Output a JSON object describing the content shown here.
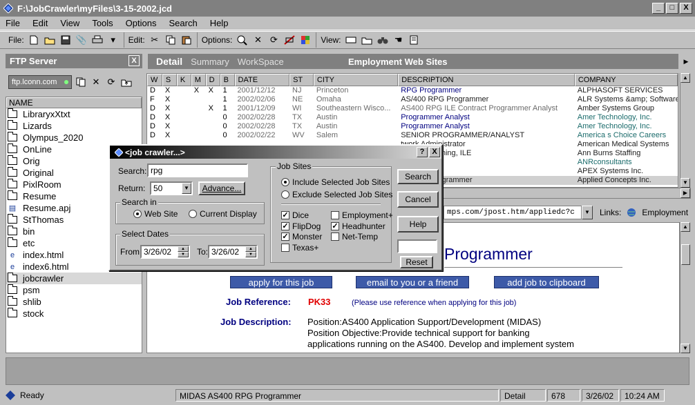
{
  "window": {
    "title": "F:\\JobCrawler\\myFiles\\3-15-2002.jcd",
    "min": "_",
    "max": "□",
    "close": "X"
  },
  "menu": [
    "File",
    "Edit",
    "View",
    "Tools",
    "Options",
    "Search",
    "Help"
  ],
  "toolbar": {
    "file_label": "File:",
    "edit_label": "Edit:",
    "options_label": "Options:",
    "view_label": "View:"
  },
  "ftp": {
    "title": "FTP Server",
    "close": "X",
    "host": "ftp.lconn.com",
    "col": "NAME",
    "items": [
      {
        "name": "LibraryxXtxt",
        "type": "folder"
      },
      {
        "name": "Lizards",
        "type": "folder"
      },
      {
        "name": "Olympus_2020",
        "type": "folder"
      },
      {
        "name": "OnLine",
        "type": "folder"
      },
      {
        "name": "Orig",
        "type": "folder"
      },
      {
        "name": "Original",
        "type": "folder"
      },
      {
        "name": "PixlRoom",
        "type": "folder"
      },
      {
        "name": "Resume",
        "type": "folder"
      },
      {
        "name": "Resume.apj",
        "type": "file"
      },
      {
        "name": "StThomas",
        "type": "folder"
      },
      {
        "name": "bin",
        "type": "folder"
      },
      {
        "name": "etc",
        "type": "folder"
      },
      {
        "name": "index.html",
        "type": "html"
      },
      {
        "name": "index6.html",
        "type": "html"
      },
      {
        "name": "jobcrawler",
        "type": "folder"
      },
      {
        "name": "psm",
        "type": "folder"
      },
      {
        "name": "shlib",
        "type": "folder"
      },
      {
        "name": "stock",
        "type": "folder"
      }
    ]
  },
  "tabs": {
    "detail": "Detail",
    "summary": "Summary",
    "workspace": "WorkSpace",
    "heading": "Employment Web Sites"
  },
  "grid": {
    "headers": [
      "W",
      "S",
      "K",
      "M",
      "D",
      "B",
      "DATE",
      "ST",
      "CITY",
      "DESCRIPTION",
      "COMPANY"
    ],
    "rows": [
      [
        "D",
        "X",
        "",
        "X",
        "X",
        "1",
        "2001/12/12",
        "NJ",
        "Princeton",
        "RPG Programmer",
        "ALPHASOFT SERVICES"
      ],
      [
        "F",
        "X",
        "",
        "",
        "",
        "1",
        "2002/02/06",
        "NE",
        "Omaha",
        "AS/400 RPG Programmer",
        "ALR Systems &amp; Software"
      ],
      [
        "D",
        "X",
        "",
        "",
        "X",
        "1",
        "2001/12/09",
        "WI",
        "Southeastern Wisco...",
        "AS400 RPG ILE Contract Programmer Analyst",
        "Amber Systems Group"
      ],
      [
        "D",
        "X",
        "",
        "",
        "",
        "0",
        "2002/02/28",
        "TX",
        "Austin",
        "Programmer Analyst",
        "Amer Technology, Inc."
      ],
      [
        "D",
        "X",
        "",
        "",
        "",
        "0",
        "2002/02/28",
        "TX",
        "Austin",
        "Programmer Analyst",
        "Amer Technology, Inc."
      ],
      [
        "D",
        "X",
        "",
        "",
        "",
        "0",
        "2002/02/22",
        "WV",
        "Salem",
        "SENIOR PROGRAMMER/ANALYST",
        "America s Choice Careers"
      ],
      [
        "",
        "",
        "",
        "",
        "",
        "",
        "",
        "",
        "",
        "twork Administrator",
        "American Medical Systems"
      ],
      [
        "",
        "",
        "",
        "",
        "",
        "",
        "",
        "",
        "",
        "IV Programming, ILE",
        "Ann Burns Staffing"
      ],
      [
        "",
        "",
        "",
        "",
        "",
        "",
        "",
        "",
        "",
        "ogrammer",
        "ANRconsultants"
      ],
      [
        "",
        "",
        "",
        "",
        "",
        "",
        "",
        "",
        "",
        "r/Analysts",
        "APEX Systems Inc."
      ],
      [
        "",
        "",
        "",
        "",
        "",
        "",
        "",
        "",
        "",
        "00 RPG Programmer",
        "Applied Concepts Inc."
      ]
    ]
  },
  "address": {
    "url": "mps.com/jpost.htm/appliedc?c",
    "links_label": "Links:",
    "links_item": "Employment"
  },
  "web": {
    "title": "Programmer",
    "apply": "apply for this job",
    "email": "email to you or a friend",
    "clip": "add job to clipboard",
    "ref_label": "Job Reference:",
    "ref_value": "PK33",
    "ref_note": "(Please use reference when applying for this job)",
    "desc_label": "Job Description:",
    "desc1": "Position:AS400 Application Support/Development (MIDAS)",
    "desc2": "Position Objective:Provide technical support for banking",
    "desc3": "applications running on the AS400. Develop and implement system"
  },
  "status": {
    "ready": "Ready",
    "job": "MIDAS AS400 RPG Programmer",
    "view": "Detail",
    "count": "678",
    "date": "3/26/02",
    "time": "10:24 AM"
  },
  "dialog": {
    "title": "<job crawler...>",
    "help": "?",
    "close": "X",
    "search_label": "Search:",
    "search_value": "rpg",
    "return_label": "Return:",
    "return_value": "50",
    "advance": "Advance...",
    "search_in": "Search in",
    "web_site": "Web Site",
    "current_display": "Current Display",
    "select_dates": "Select Dates",
    "from_label": "From:",
    "from_value": "3/26/02",
    "to_label": "To:",
    "to_value": "3/26/02",
    "job_sites": "Job Sites",
    "include": "Include Selected Job Sites",
    "exclude": "Exclude Selected Job Sites",
    "sites": [
      {
        "name": "Dice",
        "checked": true
      },
      {
        "name": "Employment+",
        "checked": false
      },
      {
        "name": "FlipDog",
        "checked": true
      },
      {
        "name": "Headhunter",
        "checked": true
      },
      {
        "name": "Monster",
        "checked": true
      },
      {
        "name": "Net-Temp",
        "checked": false
      },
      {
        "name": "Texas+",
        "checked": false
      }
    ],
    "btn_search": "Search",
    "btn_cancel": "Cancel",
    "btn_help": "Help",
    "btn_reset": "Reset"
  }
}
